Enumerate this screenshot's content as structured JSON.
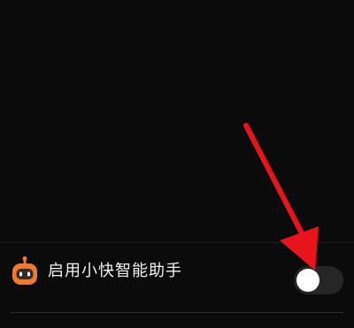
{
  "setting": {
    "label": "启用小快智能助手",
    "icon": "kuaishou-assistant-robot-icon",
    "enabled": false
  },
  "colors": {
    "background": "#0b0b0b",
    "label_text": "#f2f2f2",
    "toggle_track_off": "#262626",
    "toggle_knob": "#ffffff",
    "icon_orange": "#ef7a2f",
    "annotation_arrow": "#e8141c"
  }
}
